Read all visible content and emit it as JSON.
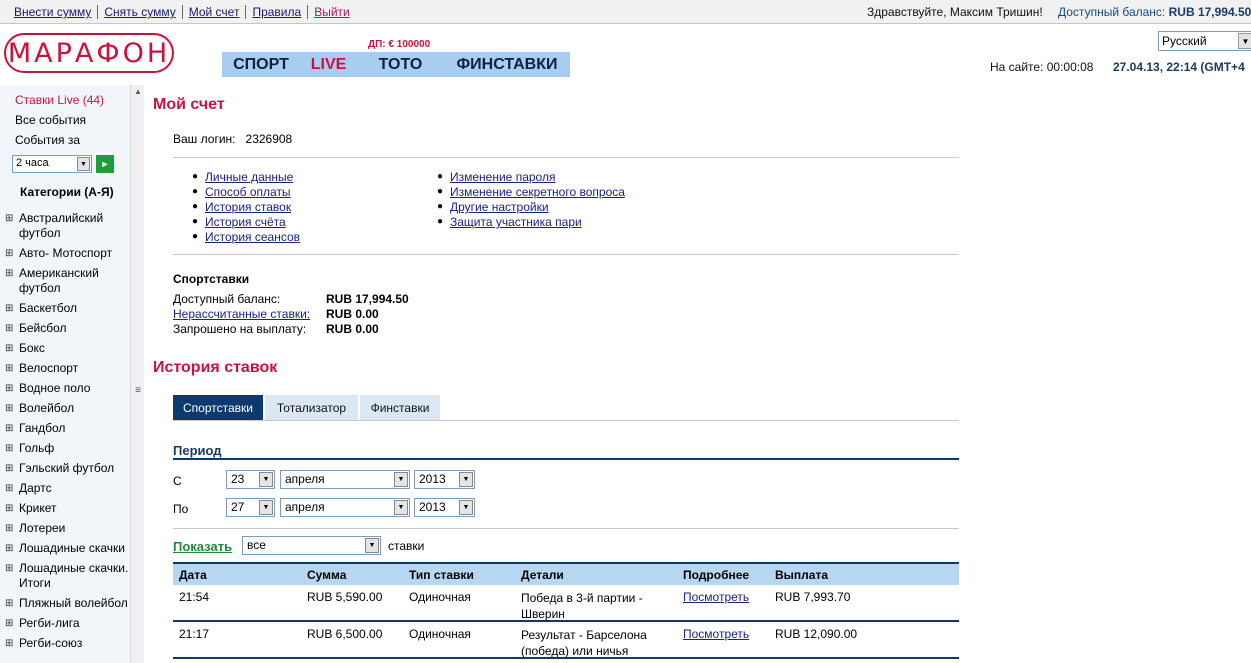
{
  "topbar": {
    "links": [
      "Внести сумму",
      "Снять сумму",
      "Мой счет",
      "Правила",
      "Выйти"
    ],
    "greeting": "Здравствуйте, Максим Тришин!",
    "balance_label": "Доступный баланс:",
    "balance_value": "RUB 17,994.50"
  },
  "header": {
    "logo": "МАРАФОН",
    "dp": "ДП: € 100000",
    "nav": [
      "СПОРТ",
      "LIVE",
      "ТОТО",
      "ФИНСТАВКИ"
    ],
    "language": "Русский",
    "online": "На сайте: 00:00:08",
    "datetime": "27.04.13, 22:14 (GMT+4"
  },
  "sidebar": {
    "live": "Ставки Live (44)",
    "all_events": "Все события",
    "events_for": "События за",
    "period_value": "2 часа",
    "categories_heading": "Категории (А-Я)",
    "categories": [
      "Австралийский футбол",
      "Авто- Мотоспорт",
      "Американский футбол",
      "Баскетбол",
      "Бейсбол",
      "Бокс",
      "Велоспорт",
      "Водное поло",
      "Волейбол",
      "Гандбол",
      "Гольф",
      "Гэльский футбол",
      "Дартс",
      "Крикет",
      "Лотереи",
      "Лошадиные скачки",
      "Лошадиные скачки. Итоги",
      "Пляжный волейбол",
      "Регби-лига",
      "Регби-союз"
    ]
  },
  "account": {
    "title": "Мой счет",
    "login_label": "Ваш логин:",
    "login_value": "2326908",
    "links_left": [
      "Личные данные",
      "Способ оплаты",
      "История ставок",
      "История счёта",
      "История сеансов"
    ],
    "links_right": [
      "Изменение пароля",
      "Изменение секретного вопроса",
      "Другие настройки",
      "Защита участника пари"
    ],
    "sport_heading": "Спортставки",
    "available_label": "Доступный баланс:",
    "available_value": "RUB 17,994.50",
    "unsettled_label": "Нерассчитанные ставки:",
    "unsettled_value": "RUB 0.00",
    "requested_label": "Запрошено на выплату:",
    "requested_value": "RUB 0.00"
  },
  "history": {
    "title": "История ставок",
    "tabs": [
      "Спортставки",
      "Тотализатор",
      "Финставки"
    ],
    "period_label": "Период",
    "from_label": "С",
    "to_label": "По",
    "from_day": "23",
    "from_month": "апреля",
    "from_year": "2013",
    "to_day": "27",
    "to_month": "апреля",
    "to_year": "2013",
    "show_label": "Показать",
    "show_value": "все",
    "show_suffix": "ставки",
    "columns": [
      "Дата",
      "Сумма",
      "Тип ставки",
      "Детали",
      "Подробнее",
      "Выплата"
    ],
    "rows": [
      {
        "date": "21:54",
        "amount": "RUB 5,590.00",
        "type": "Одиночная",
        "details": "Победа в 3-й партии - Шверин",
        "more": "Посмотреть",
        "payout": "RUB 7,993.70"
      },
      {
        "date": "21:17",
        "amount": "RUB 6,500.00",
        "type": "Одиночная",
        "details": "Результат - Барселона (победа) или ничья",
        "more": "Посмотреть",
        "payout": "RUB 12,090.00"
      }
    ]
  }
}
